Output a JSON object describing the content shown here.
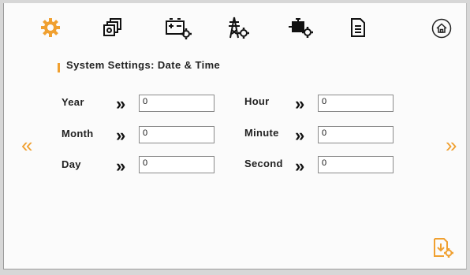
{
  "page": {
    "title": "System Settings: Date & Time"
  },
  "toolbar": {
    "items": [
      {
        "icon": "gear-icon",
        "color": "#f0a030"
      },
      {
        "icon": "module-stack-icon"
      },
      {
        "icon": "battery-settings-icon"
      },
      {
        "icon": "tower-settings-icon"
      },
      {
        "icon": "engine-settings-icon"
      },
      {
        "icon": "document-icon"
      },
      {
        "icon": "home-icon"
      }
    ]
  },
  "fields": {
    "year": {
      "label": "Year",
      "value": "0"
    },
    "month": {
      "label": "Month",
      "value": "0"
    },
    "day": {
      "label": "Day",
      "value": "0"
    },
    "hour": {
      "label": "Hour",
      "value": "0"
    },
    "minute": {
      "label": "Minute",
      "value": "0"
    },
    "second": {
      "label": "Second",
      "value": "0"
    }
  },
  "separator": "»",
  "nav": {
    "prev": "«",
    "next": "»"
  },
  "colors": {
    "accent": "#f0a030",
    "text": "#222222"
  }
}
